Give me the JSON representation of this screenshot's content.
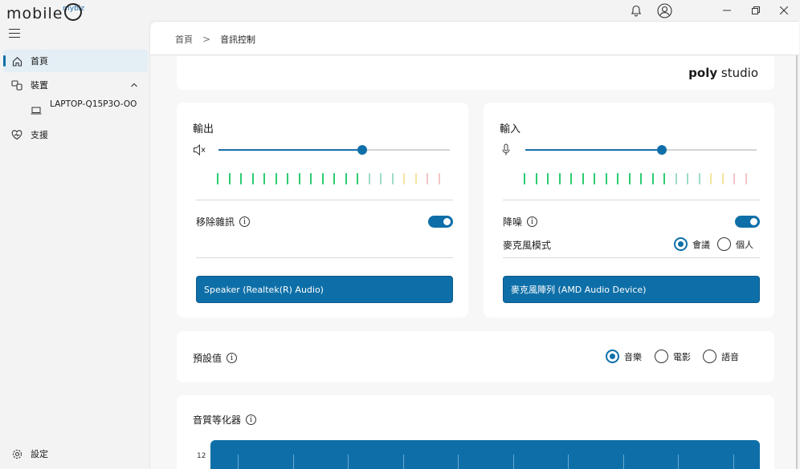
{
  "titlebar": {
    "logo_text": "mobile",
    "logo_sub": "mybiz"
  },
  "sidebar": {
    "items": [
      {
        "label": "首頁",
        "icon": "home-icon"
      },
      {
        "label": "裝置",
        "icon": "devices-icon"
      },
      {
        "label": "支援",
        "icon": "support-icon"
      }
    ],
    "device": "LAPTOP-Q15P3O-OO",
    "settings_label": "設定"
  },
  "breadcrumb": {
    "home": "首頁",
    "separator": ">",
    "current": "音訊控制"
  },
  "brand": {
    "part1": "poly",
    "part2": "studio"
  },
  "output": {
    "title": "輸出",
    "volume": 0.62,
    "noise_label": "移除雜訊",
    "noise_enabled": true,
    "device_label": "Speaker (Realtek(R) Audio)"
  },
  "input": {
    "title": "輸入",
    "volume": 0.59,
    "noise_label": "降噪",
    "noise_enabled": true,
    "mic_mode_label": "麥克風模式",
    "mic_modes": [
      "會議",
      "個人"
    ],
    "mic_mode_selected": "會議",
    "device_label": "麥克風陣列 (AMD Audio Device)"
  },
  "presets": {
    "label": "預設值",
    "options": [
      "音樂",
      "電影",
      "語音"
    ],
    "selected": "音樂"
  },
  "equalizer": {
    "title": "音質等化器",
    "y_label": "12"
  },
  "colors": {
    "accent": "#0e6fa8",
    "meter_green": "#2ecc71",
    "meter_teal": "#9fdcc8",
    "meter_yellow": "#f4e4a1",
    "meter_red": "#f3c6c6"
  }
}
